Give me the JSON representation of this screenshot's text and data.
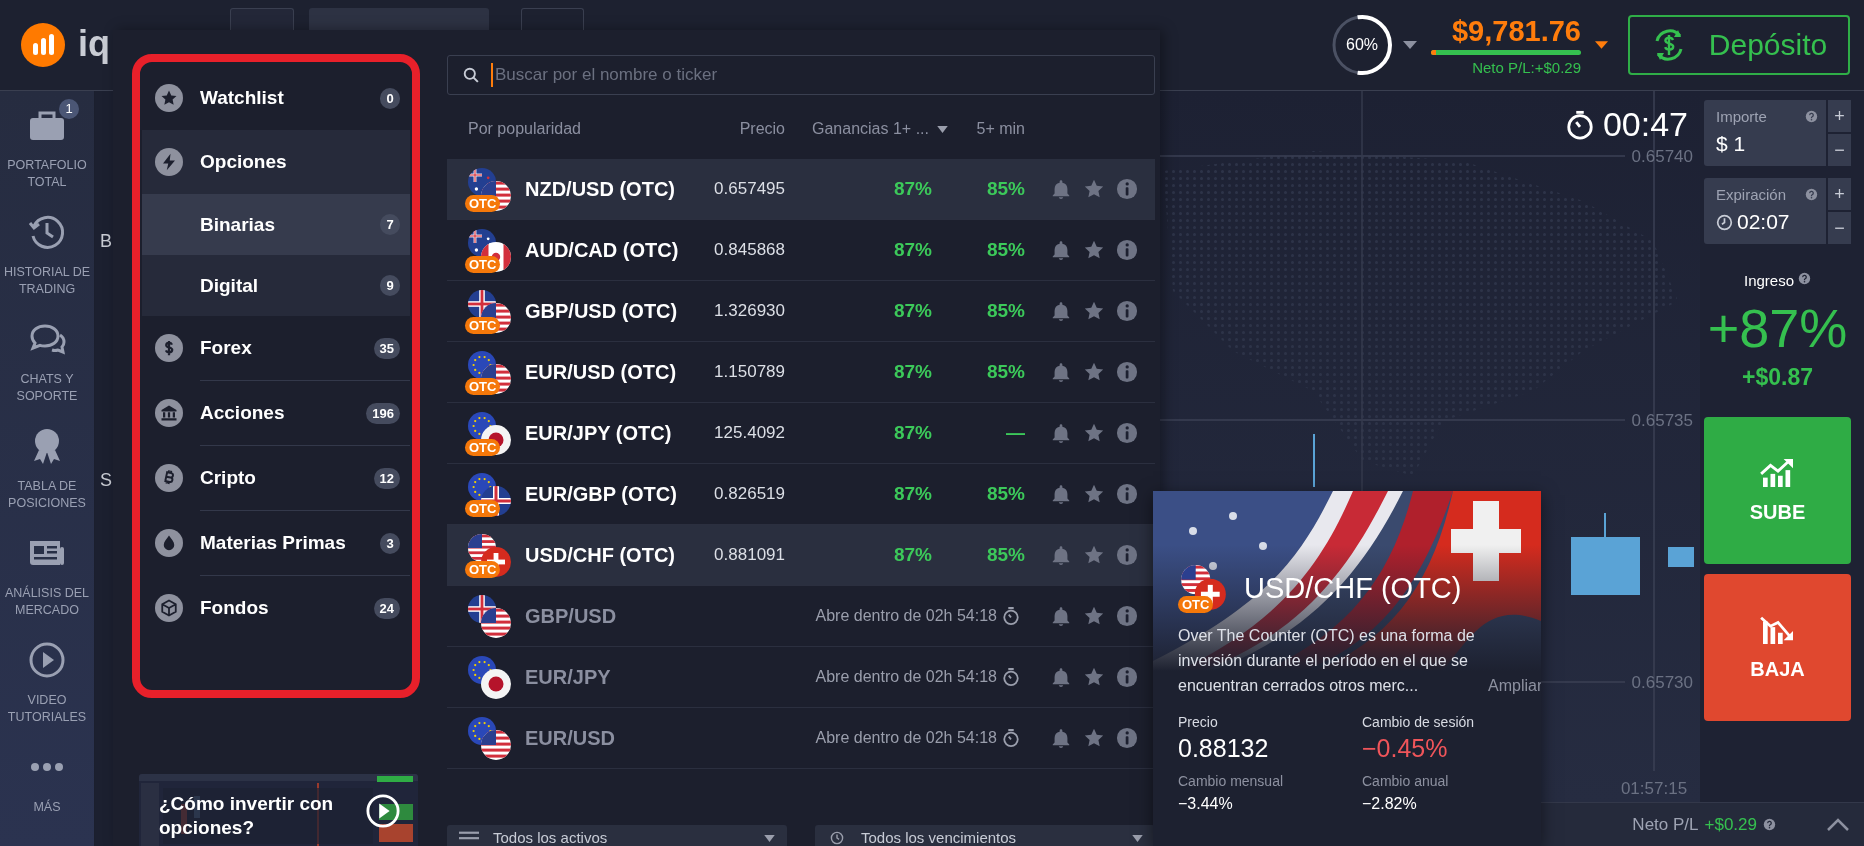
{
  "header": {
    "logo_text": "iq",
    "progress": {
      "label": "60%",
      "level": 0.6
    },
    "balance": "$9,781.76",
    "net_pl": "Neto P/L:+$0.29",
    "deposit_button": "Depósito"
  },
  "nav": {
    "items": [
      {
        "label": "PORTAFOLIO TOTAL",
        "kind": "portfolio",
        "badge": "1"
      },
      {
        "label": "HISTORIAL DE TRADING",
        "kind": "history"
      },
      {
        "label": "CHATS Y SOPORTE",
        "kind": "chat"
      },
      {
        "label": "TABLA DE POSICIONES",
        "kind": "medal"
      },
      {
        "label": "ANÁLISIS DEL MERCADO",
        "kind": "news"
      },
      {
        "label": "VIDEO TUTORIALES",
        "kind": "video"
      },
      {
        "label": "MÁS",
        "kind": "more"
      }
    ]
  },
  "partial_column": [
    "B",
    "S"
  ],
  "categories": [
    {
      "label": "Watchlist",
      "kind": "star",
      "count": "0",
      "selected": false,
      "expanded": false
    },
    {
      "label": "Opciones",
      "kind": "bolt",
      "selected": false,
      "expanded": true,
      "children": [
        {
          "label": "Binarias",
          "count": "7",
          "selected": true
        },
        {
          "label": "Digital",
          "count": "9",
          "selected": false
        }
      ]
    },
    {
      "label": "Forex",
      "kind": "dollar",
      "count": "35",
      "selected": false,
      "expanded": false
    },
    {
      "label": "Acciones",
      "kind": "bank",
      "count": "196",
      "selected": false,
      "expanded": false
    },
    {
      "label": "Cripto",
      "kind": "bitcoin",
      "count": "12",
      "selected": false,
      "expanded": false
    },
    {
      "label": "Materias Primas",
      "kind": "drop",
      "count": "3",
      "selected": false,
      "expanded": false
    },
    {
      "label": "Fondos",
      "kind": "cube",
      "count": "24",
      "selected": false,
      "expanded": false
    }
  ],
  "video": {
    "title": "¿Cómo invertir con opciones?"
  },
  "search": {
    "placeholder": "Buscar por el nombre o ticker"
  },
  "asset_table": {
    "columns": [
      "Por popularidad",
      "Precio",
      "Ganancias 1+ ...",
      "5+ min"
    ],
    "rows": [
      {
        "kind": "open",
        "name": "NZD/USD (OTC)",
        "badge": "OTC",
        "price": "0.657495",
        "profit_1": "87%",
        "profit_5": "85%",
        "selected": true
      },
      {
        "kind": "open",
        "name": "AUD/CAD (OTC)",
        "badge": "OTC",
        "price": "0.845868",
        "profit_1": "87%",
        "profit_5": "85%",
        "selected": false
      },
      {
        "kind": "open",
        "name": "GBP/USD (OTC)",
        "badge": "OTC",
        "price": "1.326930",
        "profit_1": "87%",
        "profit_5": "85%",
        "selected": false
      },
      {
        "kind": "open",
        "name": "EUR/USD (OTC)",
        "badge": "OTC",
        "price": "1.150789",
        "profit_1": "87%",
        "profit_5": "85%",
        "selected": false
      },
      {
        "kind": "open",
        "name": "EUR/JPY (OTC)",
        "badge": "OTC",
        "price": "125.4092",
        "profit_1": "87%",
        "profit_5": "—",
        "selected": false
      },
      {
        "kind": "open",
        "name": "EUR/GBP (OTC)",
        "badge": "OTC",
        "price": "0.826519",
        "profit_1": "87%",
        "profit_5": "85%",
        "selected": false
      },
      {
        "kind": "open",
        "name": "USD/CHF (OTC)",
        "badge": "OTC",
        "price": "0.881091",
        "profit_1": "87%",
        "profit_5": "85%",
        "selected": true
      },
      {
        "kind": "closed",
        "name": "GBP/USD",
        "opens": "Abre dentro de 02h 54:18",
        "selected": false
      },
      {
        "kind": "closed",
        "name": "EUR/JPY",
        "opens": "Abre dentro de 02h 54:18",
        "selected": false
      },
      {
        "kind": "closed",
        "name": "EUR/USD",
        "opens": "Abre dentro de 02h 54:18",
        "selected": false
      }
    ]
  },
  "filters": [
    "Todos los activos",
    "Todos los vencimientos"
  ],
  "asset_card": {
    "title": "USD/CHF (OTC)",
    "badge": "OTC",
    "description": "Over The Counter (OTC) es una forma de inversión durante el período en el que se encuentran cerrados otros merc...",
    "more_link": "Ampliar",
    "stats": [
      {
        "label": "Precio",
        "value": "0.88132",
        "kind": "main",
        "negative": false
      },
      {
        "label": "Cambio de sesión",
        "value": "−0.45%",
        "kind": "main",
        "negative": true
      },
      {
        "label": "Cambio mensual",
        "value": "−3.44%",
        "kind": "minor",
        "negative": false
      },
      {
        "label": "Cambio anual",
        "value": "−2.82%",
        "kind": "minor",
        "negative": false
      }
    ]
  },
  "chart": {
    "timer": "00:47",
    "price_labels": [
      "0.65740",
      "0.65735",
      "0.65730"
    ],
    "time_label": "01:57:15"
  },
  "trade_panel": {
    "amount": {
      "label": "Importe",
      "value": "$ 1",
      "plus": "+",
      "minus": "−"
    },
    "expiration": {
      "label": "Expiración",
      "value": "02:07",
      "plus": "+",
      "minus": "−"
    },
    "income_label": "Ingreso",
    "payout": "+87%",
    "profit": "+$0.87",
    "buttons": [
      {
        "label": "SUBE",
        "kind": "up"
      },
      {
        "label": "BAJA",
        "kind": "down"
      }
    ]
  },
  "footer": {
    "label": "Neto P/L",
    "value": "+$0.29"
  }
}
